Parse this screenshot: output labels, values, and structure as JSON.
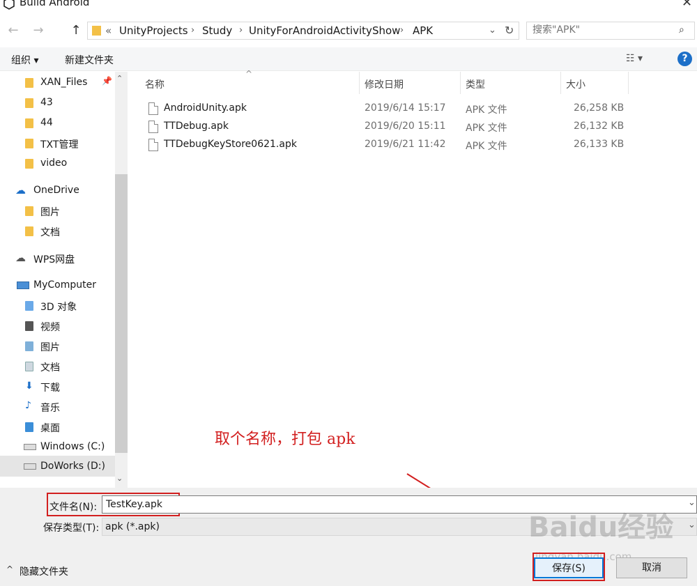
{
  "window": {
    "title": "Build Android",
    "close": "✕"
  },
  "nav": {
    "back": "←",
    "forward": "→",
    "up": "↑",
    "breadcrumb": [
      "«",
      "UnityProjects",
      "Study",
      "UnityForAndroidActivityShow",
      "APK"
    ],
    "search_placeholder": "搜索\"APK\""
  },
  "toolbar": {
    "organize": "组织 ▾",
    "new_folder": "新建文件夹"
  },
  "sidebar": {
    "items": [
      {
        "label": "XAN_Files",
        "icon": "folder-icon"
      },
      {
        "label": "43",
        "icon": "folder-icon"
      },
      {
        "label": "44",
        "icon": "folder-icon"
      },
      {
        "label": "TXT管理",
        "icon": "folder-icon"
      },
      {
        "label": "video",
        "icon": "folder-icon"
      },
      {
        "label": "OneDrive",
        "icon": "cloud-icon"
      },
      {
        "label": "图片",
        "icon": "folder-icon"
      },
      {
        "label": "文档",
        "icon": "folder-icon"
      },
      {
        "label": "WPS网盘",
        "icon": "cloud-icon"
      },
      {
        "label": "MyComputer",
        "icon": "computer-icon"
      },
      {
        "label": "3D 对象",
        "icon": "folder-icon"
      },
      {
        "label": "视频",
        "icon": "folder-icon"
      },
      {
        "label": "图片",
        "icon": "folder-icon"
      },
      {
        "label": "文档",
        "icon": "folder-icon"
      },
      {
        "label": "下载",
        "icon": "download-icon"
      },
      {
        "label": "音乐",
        "icon": "music-icon"
      },
      {
        "label": "桌面",
        "icon": "folder-icon"
      },
      {
        "label": "Windows (C:)",
        "icon": "drive-icon"
      },
      {
        "label": "DoWorks (D:)",
        "icon": "drive-icon"
      }
    ]
  },
  "columns": {
    "name": "名称",
    "modified": "修改日期",
    "type": "类型",
    "size": "大小"
  },
  "files": [
    {
      "name": "AndroidUnity.apk",
      "modified": "2019/6/14 15:17",
      "type": "APK 文件",
      "size": "26,258 KB"
    },
    {
      "name": "TTDebug.apk",
      "modified": "2019/6/20 15:11",
      "type": "APK 文件",
      "size": "26,132 KB"
    },
    {
      "name": "TTDebugKeyStore0621.apk",
      "modified": "2019/6/21 11:42",
      "type": "APK 文件",
      "size": "26,133 KB"
    }
  ],
  "form": {
    "filename_label": "文件名(N):",
    "filename_value": "TestKey.apk",
    "filetype_label": "保存类型(T):",
    "filetype_value": "apk (*.apk)"
  },
  "footer": {
    "hide_folders": "隐藏文件夹",
    "save": "保存(S)",
    "cancel": "取消"
  },
  "annotation": "取个名称，打包 apk",
  "watermark": {
    "main": "Baidu经验",
    "sub": "jingyan.baidu.com"
  },
  "colors": {
    "annotation_red": "#d21f1f",
    "folder_yellow": "#f3c047",
    "accent_blue": "#0078d7"
  }
}
